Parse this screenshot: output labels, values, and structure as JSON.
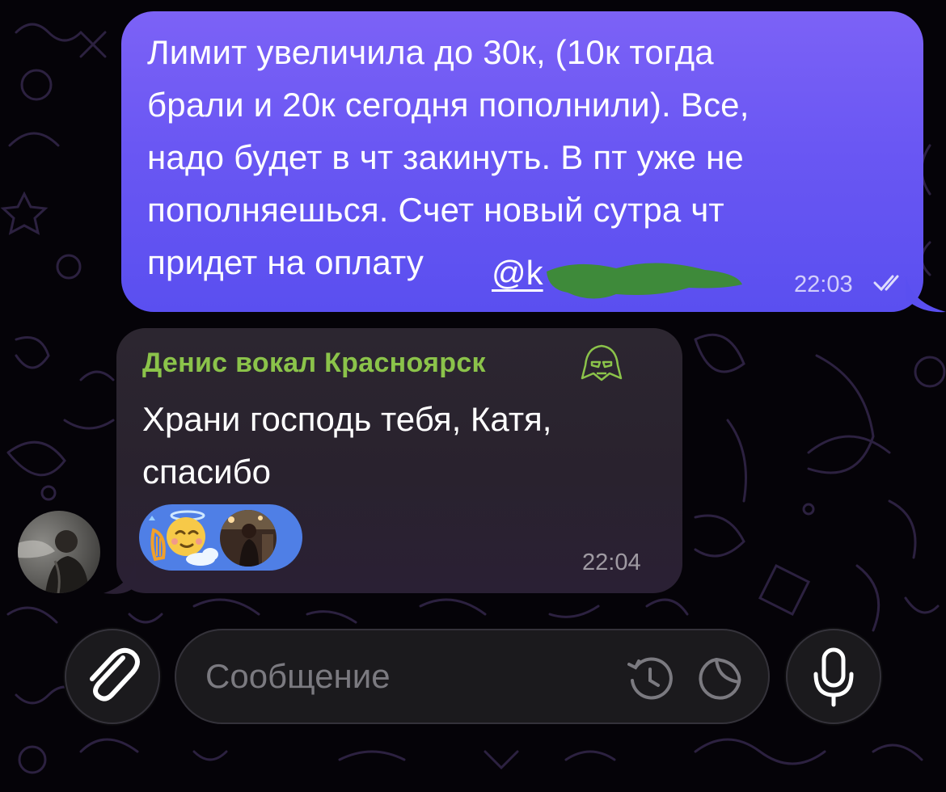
{
  "outgoing": {
    "text": "Лимит увеличила до 30к, (10к тогда\nбрали и 20к сегодня пополнили). Все,\nнадо будет в чт закинуть. В пт уже не\nпополняешься. Счет новый сутра чт\nпридет на оплату",
    "mention": "@k",
    "time": "22:03",
    "status_icon": "double-check-icon",
    "bubble_color": "#6a57f3"
  },
  "incoming": {
    "sender": "Денис вокал Красноярск",
    "sender_color": "#8bc34a",
    "text": "Храни господь тебя, Катя,\nспасибо",
    "time": "22:04",
    "reaction_color": "#4f7fe6",
    "reaction_icon": "angel-harp-emoji"
  },
  "composer": {
    "placeholder": "Сообщение",
    "attach_icon": "paperclip-icon",
    "timer_icon": "scheduled-timer-icon",
    "sticker_icon": "sticker-icon",
    "mic_icon": "microphone-icon"
  }
}
